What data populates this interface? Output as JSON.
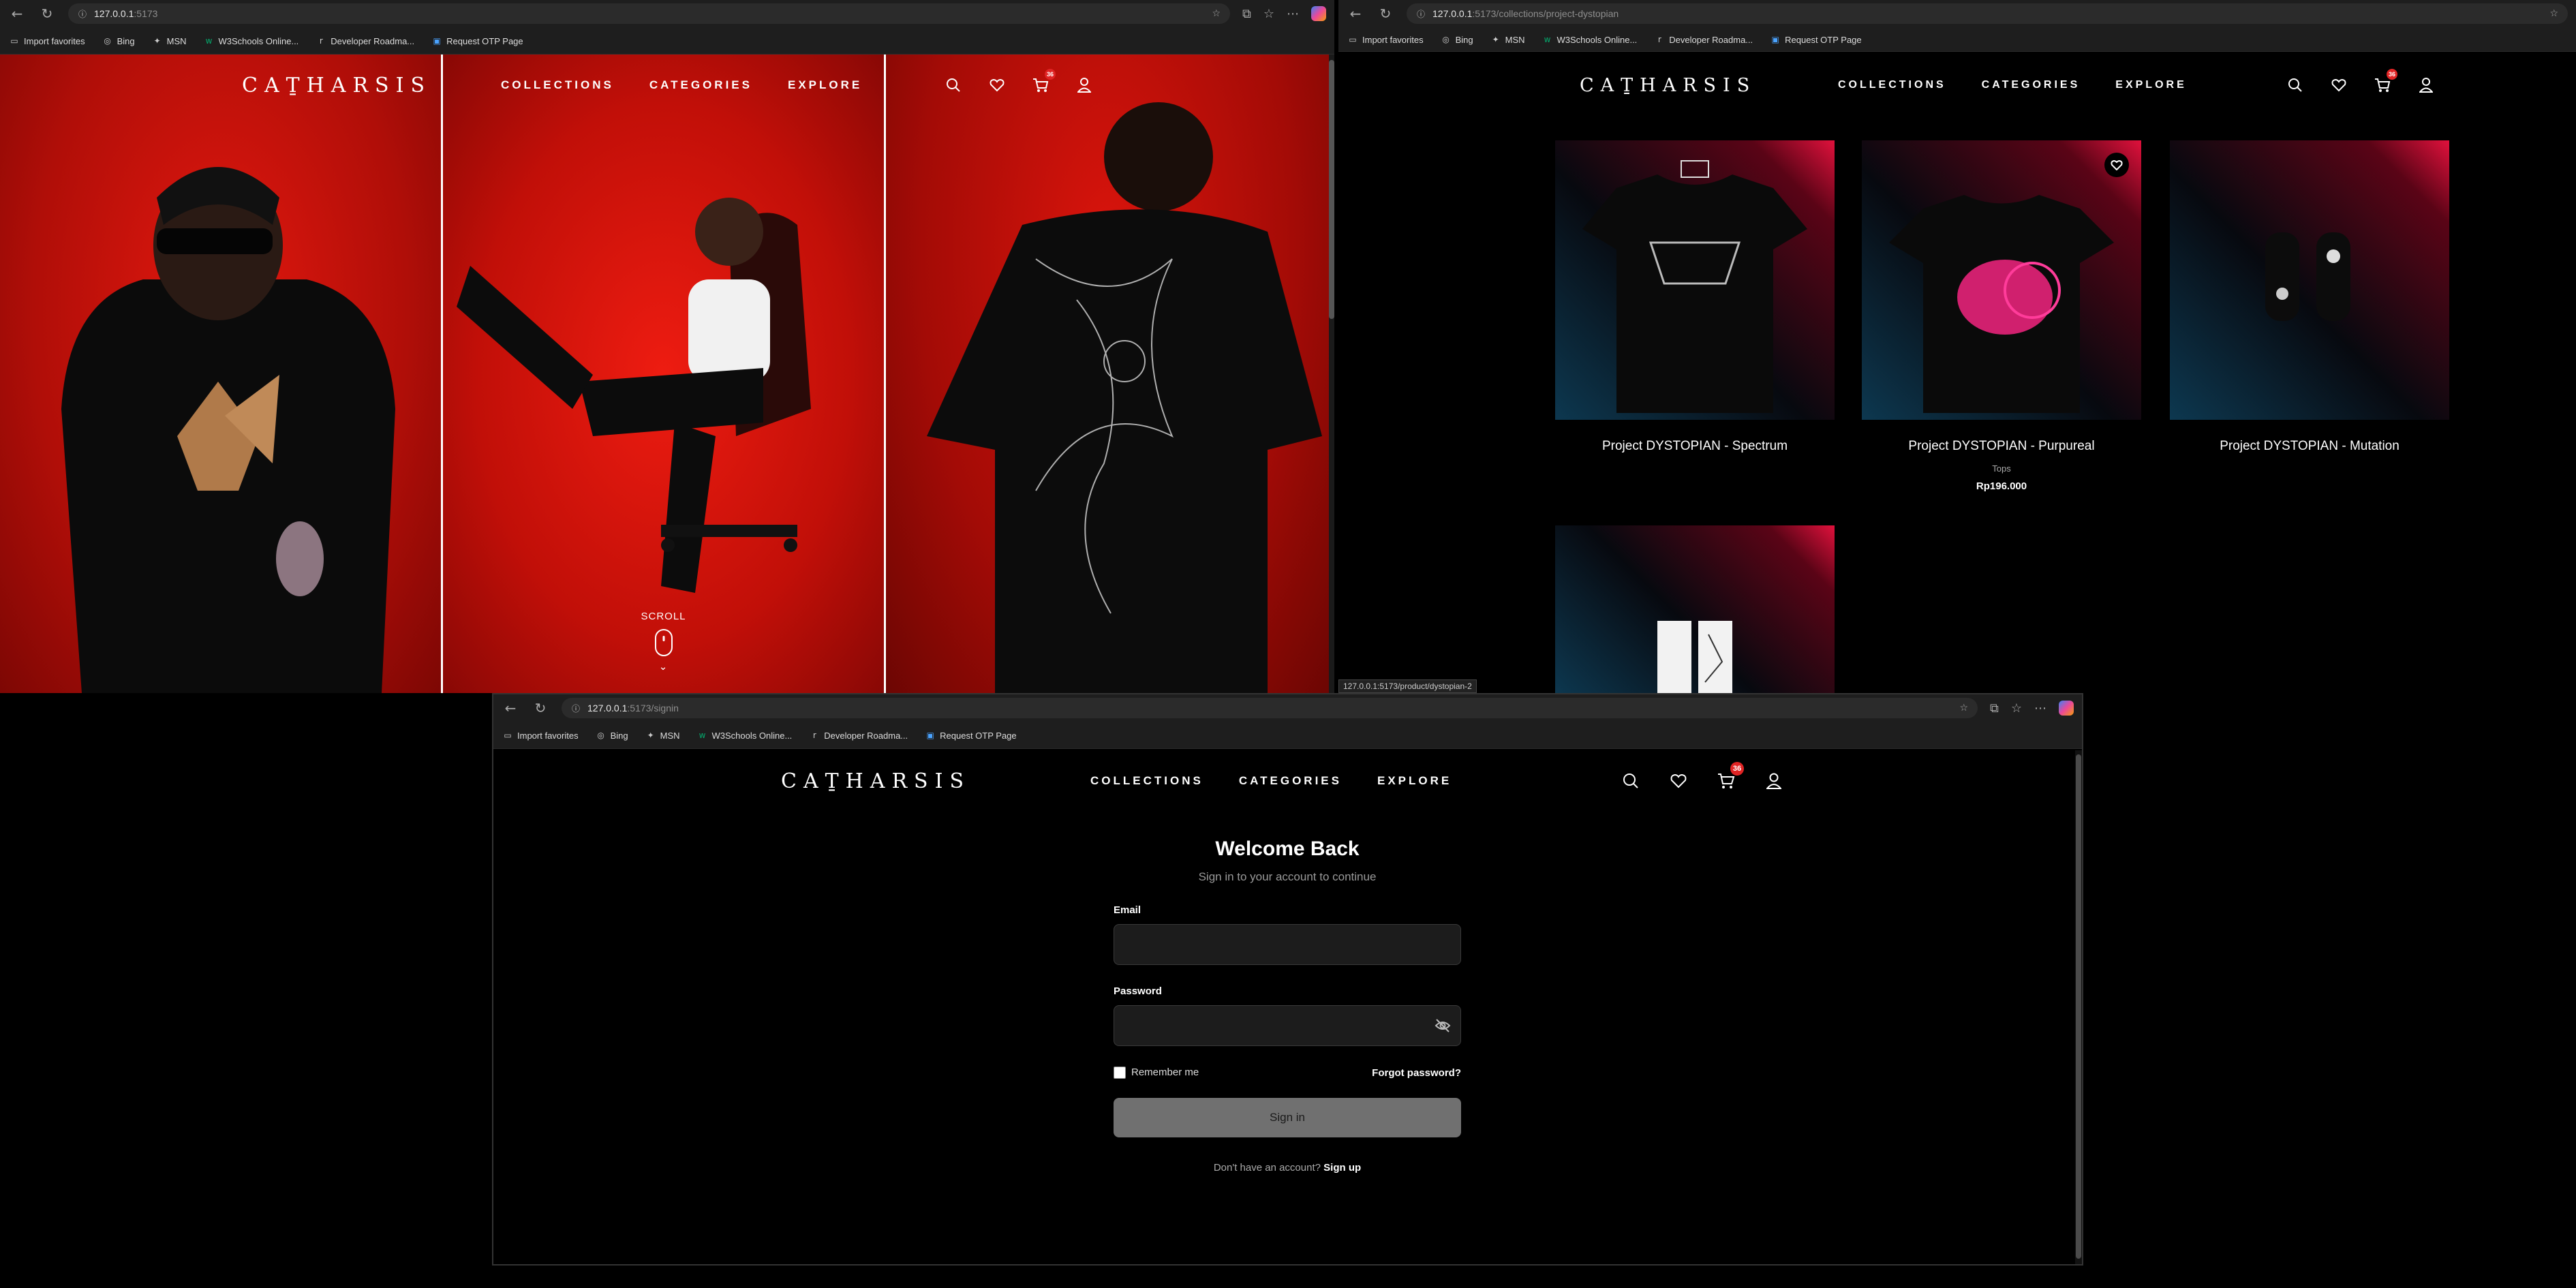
{
  "favorites": [
    "Import favorites",
    "Bing",
    "MSN",
    "W3Schools Online...",
    "Developer Roadma...",
    "Request OTP Page"
  ],
  "site": {
    "logo": "CAṮHARSIS",
    "menu": [
      "COLLECTIONS",
      "CATEGORIES",
      "EXPLORE"
    ],
    "cart_count": "36"
  },
  "window1": {
    "url_host": "127.0.0.1",
    "url_path": ":5173",
    "scroll_label": "SCROLL"
  },
  "window2": {
    "url_host": "127.0.0.1",
    "url_path": ":5173/collections/project-dystopian",
    "products": [
      {
        "name": "Project DYSTOPIAN - Spectrum",
        "category": "",
        "price": ""
      },
      {
        "name": "Project DYSTOPIAN - Purpureal",
        "category": "Tops",
        "price": "Rp196.000"
      },
      {
        "name": "Project DYSTOPIAN - Mutation",
        "category": "",
        "price": ""
      },
      {
        "name": "",
        "category": "",
        "price": ""
      }
    ],
    "status_url": "127.0.0.1:5173/product/dystopian-2"
  },
  "window3": {
    "url_host": "127.0.0.1",
    "url_path": ":5173/signin",
    "title": "Welcome Back",
    "subtitle": "Sign in to your account to continue",
    "email_label": "Email",
    "password_label": "Password",
    "remember_label": "Remember me",
    "forgot_label": "Forgot password?",
    "signin_label": "Sign in",
    "no_account_text": "Don't have an account?",
    "signup_label": "Sign up"
  },
  "colors": {
    "accent_red": "#e02424",
    "hero_red": "#d9140c",
    "button_gray": "#707070"
  }
}
